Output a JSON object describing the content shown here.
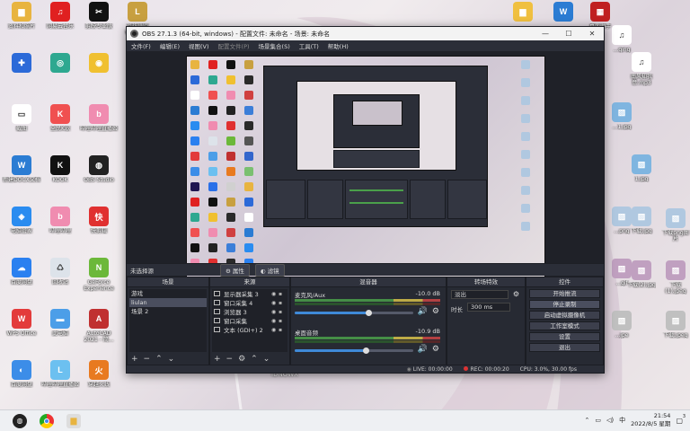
{
  "desktop": {
    "icons_left": [
      {
        "label": "资料和照片",
        "color": "#e8b440",
        "glyph": "▆"
      },
      {
        "label": "网易云音乐",
        "color": "#e02020",
        "glyph": "♫"
      },
      {
        "label": "剪映专业版",
        "color": "#111111",
        "glyph": "✂"
      },
      {
        "label": "英雄联盟 WeGame",
        "color": "#c8a040",
        "glyph": "L"
      },
      {
        "label": "",
        "color": "#2c6ad8",
        "glyph": "✚"
      },
      {
        "label": "",
        "color": "#2ea890",
        "glyph": "◎"
      },
      {
        "label": "",
        "color": "#f0c030",
        "glyph": "◉"
      },
      {
        "label": "",
        "color": "#2a2a2a",
        "glyph": "▣"
      },
      {
        "label": "截图",
        "color": "#ffffff",
        "glyph": "▭"
      },
      {
        "label": "全民K歌",
        "color": "#f05050",
        "glyph": "K"
      },
      {
        "label": "哔哩哔哩直播姬",
        "color": "#f08cb0",
        "glyph": "b"
      },
      {
        "label": "",
        "color": "#d04040",
        "glyph": "A"
      },
      {
        "label": "新建DOCX文档",
        "color": "#2b7cd3",
        "glyph": "W"
      },
      {
        "label": "KOOK",
        "color": "#111111",
        "glyph": "K"
      },
      {
        "label": "OBS Studio",
        "color": "#222222",
        "glyph": "◍"
      },
      {
        "label": "",
        "color": "#3b7ed8",
        "glyph": "U"
      },
      {
        "label": "电脑管家",
        "color": "#2a8cf0",
        "glyph": "◈"
      },
      {
        "label": "哔哩哔哩",
        "color": "#f08cb0",
        "glyph": "b"
      },
      {
        "label": "快剪辑",
        "color": "#e03030",
        "glyph": "快"
      },
      {
        "label": "",
        "color": "#2a2a2a",
        "glyph": "W"
      },
      {
        "label": "百度网盘",
        "color": "#2a80f0",
        "glyph": "☁"
      },
      {
        "label": "回收站",
        "color": "#dde3ea",
        "glyph": "♺"
      },
      {
        "label": "GeForce Experience",
        "color": "#6cb83a",
        "glyph": "N"
      },
      {
        "label": "Edi...",
        "color": "#555555",
        "glyph": "E"
      },
      {
        "label": "WPS Office",
        "color": "#e33b3b",
        "glyph": "W"
      },
      {
        "label": "此电脑",
        "color": "#4c9ee8",
        "glyph": "▬"
      },
      {
        "label": "AutoCAD 2021 - 简...",
        "color": "#c03030",
        "glyph": "A"
      },
      {
        "label": "Wi...",
        "color": "#3366cc",
        "glyph": "W"
      },
      {
        "label": "百度网盘",
        "color": "#3c8de8",
        "glyph": "◐"
      },
      {
        "label": "哔哩哔哩直播姬",
        "color": "#6cc0f0",
        "glyph": "L"
      },
      {
        "label": "穿越火线",
        "color": "#e87a20",
        "glyph": "火"
      },
      {
        "label": "",
        "color": "#7ac070",
        "glyph": "◍"
      },
      {
        "label": "Adobe Premiere...",
        "color": "#1f1550",
        "glyph": "Pr"
      },
      {
        "label": "腾讯会议",
        "color": "#2a70e8",
        "glyph": "▲"
      },
      {
        "label": "FormatFact...",
        "color": "#d0d0d0",
        "glyph": "◆"
      }
    ],
    "icons_right": [
      {
        "label": "",
        "color": "#f0c040",
        "glyph": "▆"
      },
      {
        "label": "",
        "color": "#2b7cd3",
        "glyph": "W"
      },
      {
        "label": "桌面助手",
        "color": "#c02020",
        "glyph": "▦"
      },
      {
        "label": "...qing",
        "color": "#ffffff",
        "glyph": "♫"
      },
      {
        "label": "南风知我意.mp3",
        "color": "#ffffff",
        "glyph": "♫"
      },
      {
        "label": "...1.jpg",
        "color": "#7fb5e0",
        "glyph": "▨"
      },
      {
        "label": "1.jpg",
        "color": "#7fb5e0",
        "glyph": "▨"
      },
      {
        "label": "...png",
        "color": "#b0c8e0",
        "glyph": "▨"
      },
      {
        "label": "下载png图片",
        "color": "#b0c8e0",
        "glyph": "▨"
      },
      {
        "label": "下载.jpg",
        "color": "#b0c8e0",
        "glyph": "▨"
      },
      {
        "label": "...gif",
        "color": "#c0a0c0",
        "glyph": "▨"
      },
      {
        "label": "下载(1).jpeg",
        "color": "#c0a0c0",
        "glyph": "▨"
      },
      {
        "label": "下载(2).jpg",
        "color": "#c0a0c0",
        "glyph": "▨"
      },
      {
        "label": "...jpe",
        "color": "#c0c0c0",
        "glyph": "▨"
      },
      {
        "label": "下载.jpeg",
        "color": "#c0c0c0",
        "glyph": "▨"
      }
    ],
    "wallpaper_text": "IDNOWX"
  },
  "obs": {
    "title": "OBS 27.1.3 (64-bit, windows) - 配置文件: 未命名 - 场景: 未命名",
    "menu": [
      "文件(F)",
      "编辑(E)",
      "视图(V)",
      "配置文件(P)",
      "场景集合(S)",
      "工具(T)",
      "帮助(H)"
    ],
    "source_bar": {
      "label": "未选择源",
      "properties": "属性",
      "filters": "滤镜"
    },
    "scenes": {
      "title": "场景",
      "items": [
        "游戏",
        "liulan",
        "场景 2"
      ],
      "selected": 1
    },
    "sources": {
      "title": "来源",
      "items": [
        "显示器采集 3",
        "窗口采集 4",
        "浏览器 3",
        "窗口采集",
        "文本 (GDI+) 2"
      ]
    },
    "mixer": {
      "title": "混音器",
      "tracks": [
        {
          "name": "麦克风/Aux",
          "db": "-10.0 dB",
          "level": 0.62
        },
        {
          "name": "桌面音频",
          "db": "-10.9 dB",
          "level": 0.6
        }
      ]
    },
    "transitions": {
      "title": "转场特效",
      "type": "淡出",
      "duration_label": "时长",
      "duration": "300 ms"
    },
    "controls": {
      "title": "控件",
      "buttons": [
        "开始推流",
        "停止录制",
        "启动虚拟摄像机",
        "工作室模式",
        "设置",
        "退出"
      ],
      "active": 1
    },
    "status": {
      "live": "LIVE: 00:00:00",
      "rec": "REC: 00:00:20",
      "cpu": "CPU: 3.0%, 30.00 fps"
    }
  },
  "taskbar": {
    "time": "21:54",
    "date": "2022/8/5 星期",
    "tray_badge": "3"
  }
}
